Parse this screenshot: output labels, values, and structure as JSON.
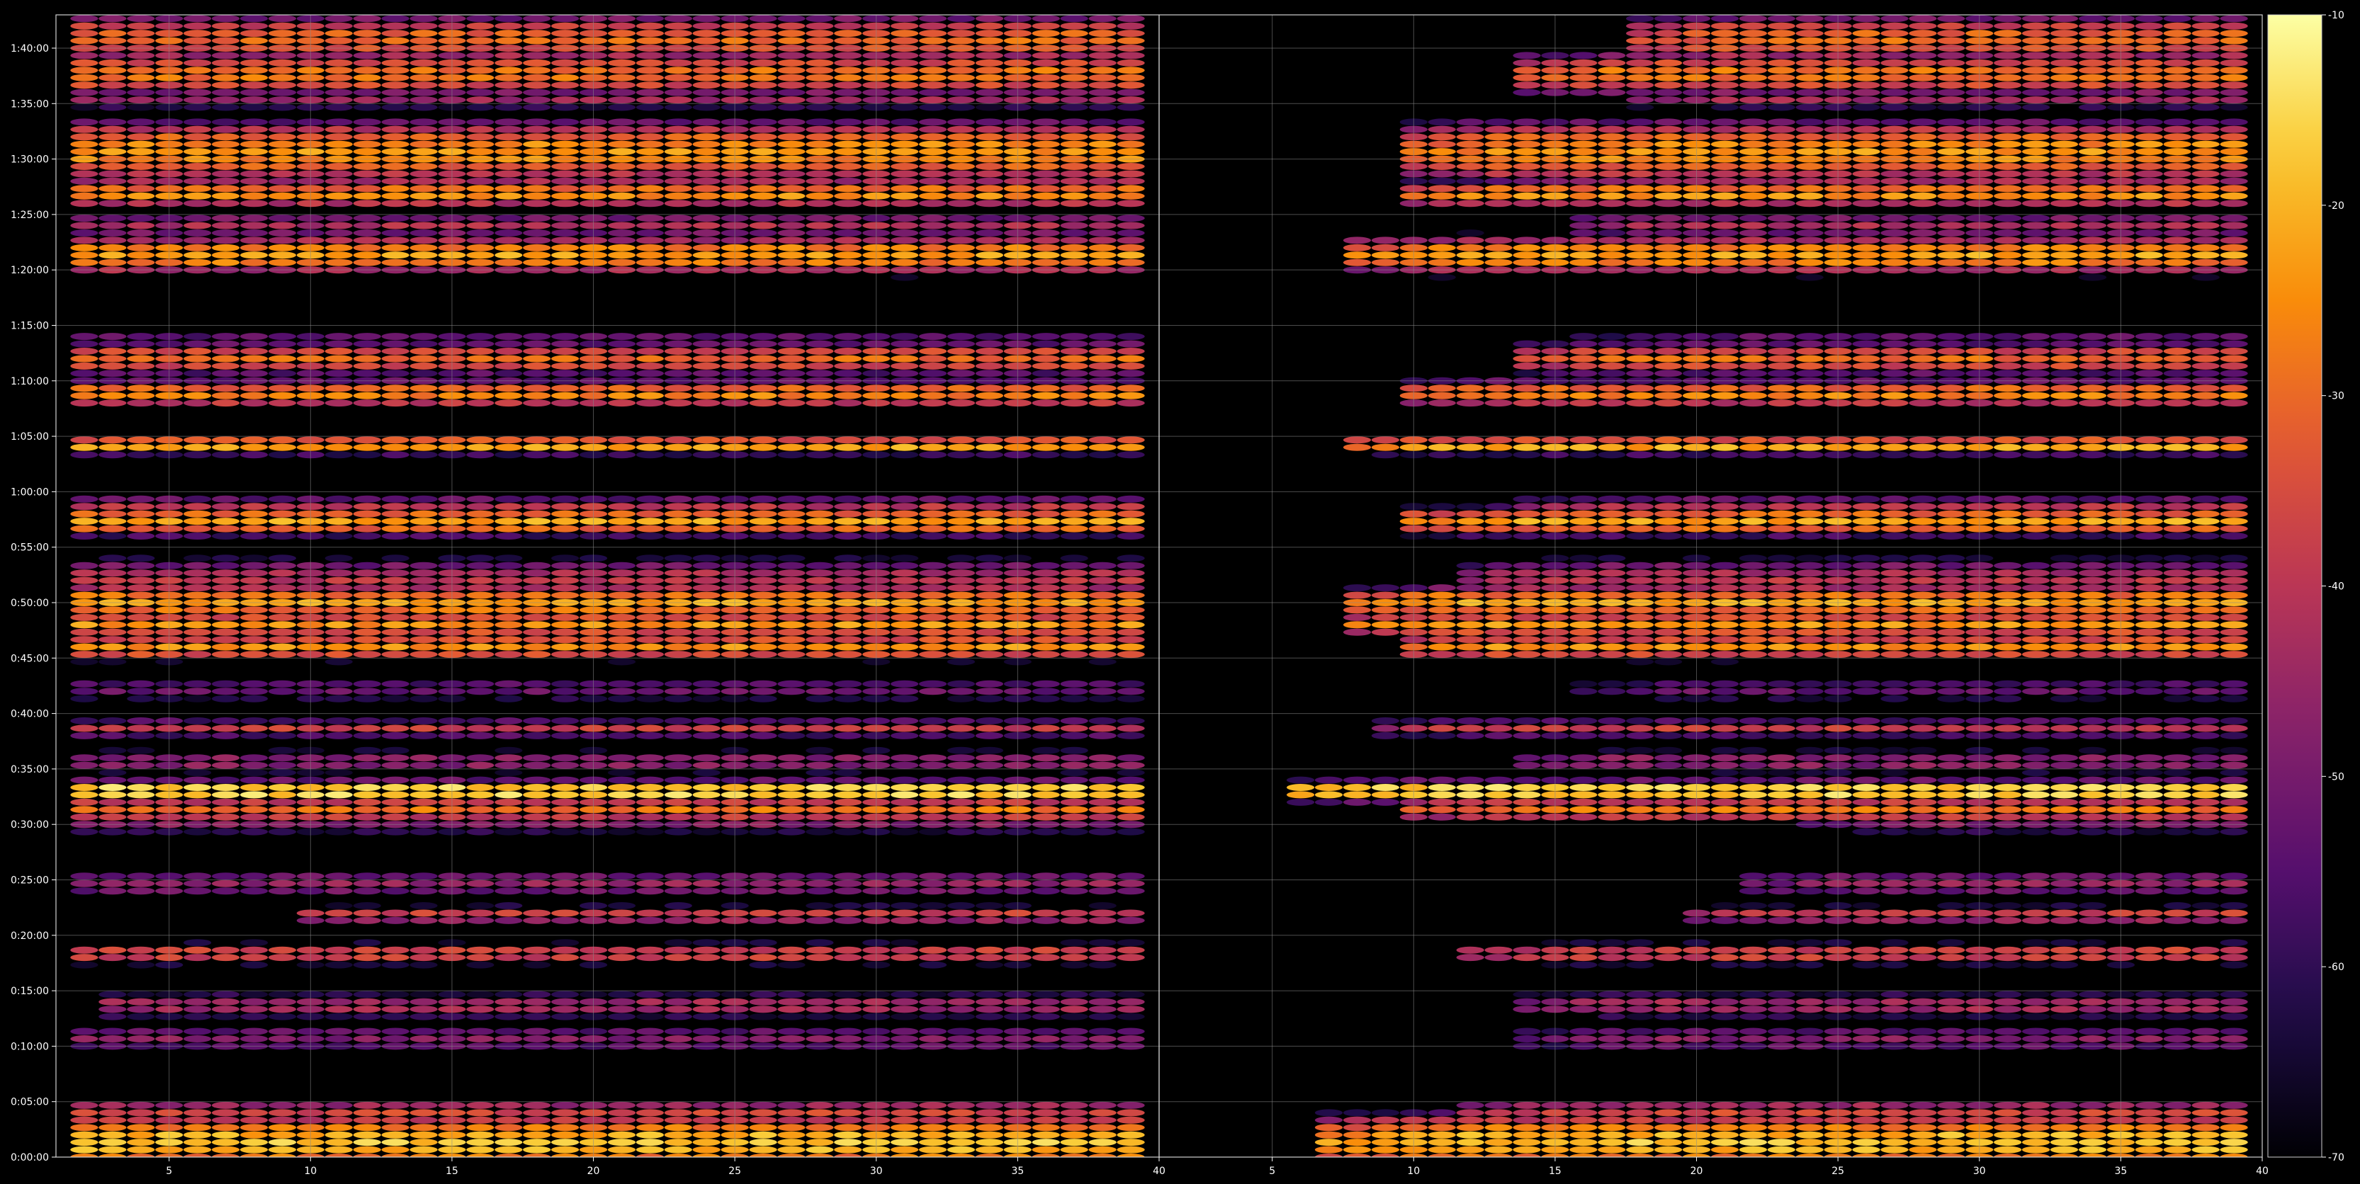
{
  "chart_data": {
    "type": "heatmap",
    "title": "",
    "colormap": "inferno",
    "background": "#000000",
    "grid": true,
    "panels": [
      {
        "name": "left",
        "xlim": [
          1,
          40
        ],
        "xticks": [
          "5",
          "10",
          "15",
          "20",
          "25",
          "30",
          "35",
          "40"
        ],
        "x_first_cell": 2,
        "x_last_cell": 39,
        "x_step": 1
      },
      {
        "name": "right",
        "xlim": [
          1,
          40
        ],
        "xticks": [
          "5",
          "10",
          "15",
          "20",
          "25",
          "30",
          "35",
          "40"
        ],
        "x_first_cell": 2,
        "x_last_cell": 39,
        "x_step": 1
      }
    ],
    "ylim_seconds": [
      0,
      6180
    ],
    "yticks": [
      "0:00:00",
      "0:05:00",
      "0:10:00",
      "0:15:00",
      "0:20:00",
      "0:25:00",
      "0:30:00",
      "0:35:00",
      "0:40:00",
      "0:45:00",
      "0:50:00",
      "0:55:00",
      "1:00:00",
      "1:05:00",
      "1:10:00",
      "1:15:00",
      "1:20:00",
      "1:25:00",
      "1:30:00",
      "1:35:00",
      "1:40:00"
    ],
    "row_step_seconds": 40,
    "colorbar": {
      "label": "",
      "range": [
        -70,
        -10
      ],
      "ticks": [
        "-10",
        "-20",
        "-30",
        "-40",
        "-50",
        "-60",
        "-70"
      ]
    },
    "bands": [
      {
        "t": 80,
        "peak": -18,
        "width": 95,
        "left_start": 2,
        "right_start": 7
      },
      {
        "t": 150,
        "peak": -30,
        "width": 60,
        "left_start": 2,
        "right_start": 9
      },
      {
        "t": 240,
        "peak": -36,
        "width": 50,
        "left_start": 2,
        "right_start": 12
      },
      {
        "t": 640,
        "peak": -48,
        "width": 60,
        "left_start": 2,
        "right_start": 14
      },
      {
        "t": 820,
        "peak": -42,
        "width": 50,
        "left_start": 3,
        "right_start": 14
      },
      {
        "t": 1100,
        "peak": -34,
        "width": 40,
        "left_start": 2,
        "right_start": 12
      },
      {
        "t": 1310,
        "peak": -36,
        "width": 35,
        "left_start": 10,
        "right_start": 20
      },
      {
        "t": 1480,
        "peak": -46,
        "width": 60,
        "left_start": 2,
        "right_start": 22
      },
      {
        "t": 1800,
        "peak": -48,
        "width": 40,
        "left_start": 2,
        "right_start": 24
      },
      {
        "t": 1880,
        "peak": -28,
        "width": 45,
        "left_start": 2,
        "right_start": 10
      },
      {
        "t": 1980,
        "peak": -12,
        "width": 35,
        "left_start": 2,
        "right_start": 6
      },
      {
        "t": 2140,
        "peak": -46,
        "width": 50,
        "left_start": 2,
        "right_start": 14
      },
      {
        "t": 2320,
        "peak": -38,
        "width": 35,
        "left_start": 2,
        "right_start": 9
      },
      {
        "t": 2530,
        "peak": -52,
        "width": 55,
        "left_start": 2,
        "right_start": 16
      },
      {
        "t": 2760,
        "peak": -24,
        "width": 45,
        "left_start": 2,
        "right_start": 10
      },
      {
        "t": 2880,
        "peak": -24,
        "width": 45,
        "left_start": 2,
        "right_start": 8
      },
      {
        "t": 3000,
        "peak": -22,
        "width": 55,
        "left_start": 2,
        "right_start": 8
      },
      {
        "t": 3120,
        "peak": -40,
        "width": 90,
        "left_start": 2,
        "right_start": 12
      },
      {
        "t": 3440,
        "peak": -22,
        "width": 50,
        "left_start": 2,
        "right_start": 10
      },
      {
        "t": 3520,
        "peak": -40,
        "width": 40,
        "left_start": 2,
        "right_start": 14
      },
      {
        "t": 3850,
        "peak": -20,
        "width": 30,
        "left_start": 2,
        "right_start": 8
      },
      {
        "t": 4130,
        "peak": -26,
        "width": 50,
        "left_start": 2,
        "right_start": 10
      },
      {
        "t": 4320,
        "peak": -30,
        "width": 60,
        "left_start": 2,
        "right_start": 14
      },
      {
        "t": 4420,
        "peak": -48,
        "width": 30,
        "left_start": 2,
        "right_start": 16
      },
      {
        "t": 4880,
        "peak": -22,
        "width": 65,
        "left_start": 2,
        "right_start": 8
      },
      {
        "t": 5040,
        "peak": -42,
        "width": 50,
        "left_start": 2,
        "right_start": 16
      },
      {
        "t": 5210,
        "peak": -24,
        "width": 45,
        "left_start": 2,
        "right_start": 10
      },
      {
        "t": 5300,
        "peak": -40,
        "width": 40,
        "left_start": 2,
        "right_start": 14
      },
      {
        "t": 5440,
        "peak": -24,
        "width": 110,
        "left_start": 2,
        "right_start": 10
      },
      {
        "t": 5720,
        "peak": -44,
        "width": 35,
        "left_start": 2,
        "right_start": 18
      },
      {
        "t": 5860,
        "peak": -28,
        "width": 80,
        "left_start": 2,
        "right_start": 14
      },
      {
        "t": 6050,
        "peak": -30,
        "width": 90,
        "left_start": 2,
        "right_start": 18
      }
    ]
  }
}
